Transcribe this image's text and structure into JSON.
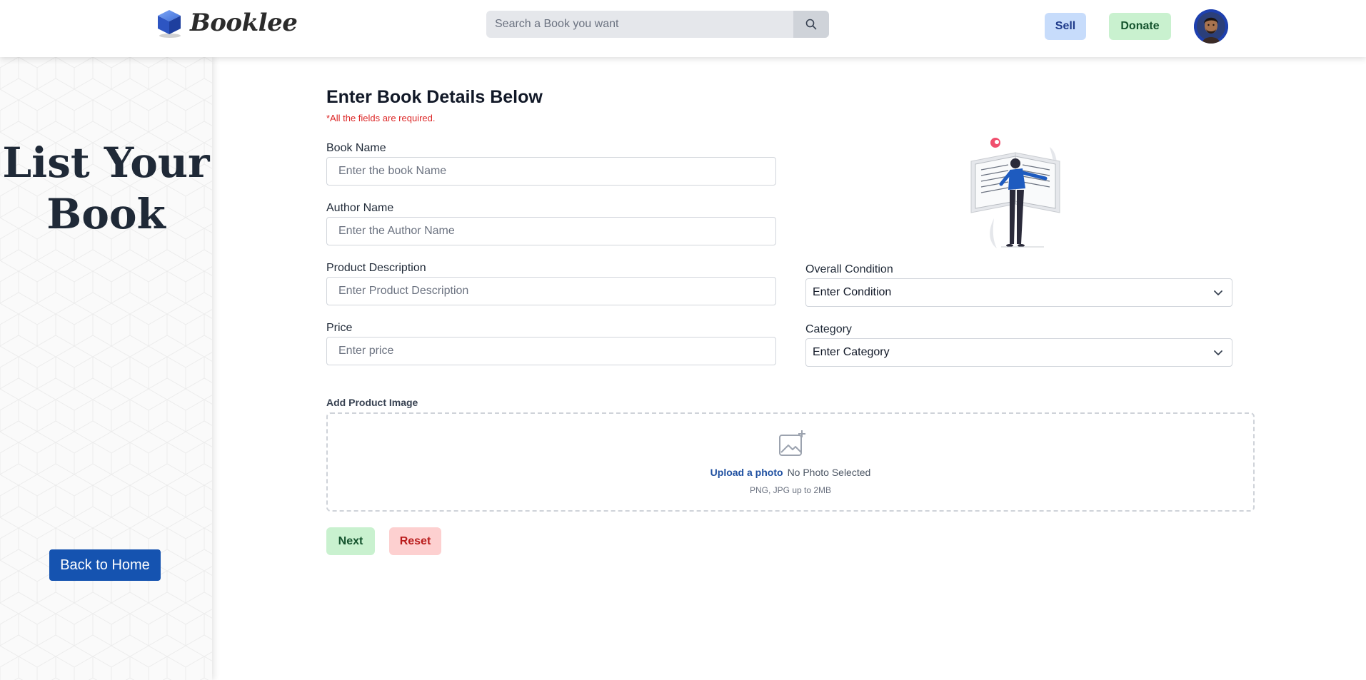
{
  "header": {
    "brand": "Booklee",
    "search_placeholder": "Search a Book you want",
    "sell_label": "Sell",
    "donate_label": "Donate"
  },
  "sidebar": {
    "title_line1": "List Your",
    "title_line2": "Book",
    "back_home_label": "Back to Home"
  },
  "form": {
    "title": "Enter Book Details Below",
    "required_note": "*All the fields are required.",
    "book_name": {
      "label": "Book Name",
      "placeholder": "Enter the book Name"
    },
    "author_name": {
      "label": "Author Name",
      "placeholder": "Enter the Author Name"
    },
    "description": {
      "label": "Product Description",
      "placeholder": "Enter Product Description"
    },
    "price": {
      "label": "Price",
      "placeholder": "Enter price"
    },
    "condition": {
      "label": "Overall Condition",
      "value": "Enter Condition"
    },
    "category": {
      "label": "Category",
      "value": "Enter Category"
    },
    "image": {
      "label": "Add Product Image",
      "upload_label": "Upload a photo",
      "status": "No Photo Selected",
      "hint": "PNG, JPG up to 2MB"
    },
    "next_label": "Next",
    "reset_label": "Reset"
  },
  "icons": {
    "logo": "cube-logo-icon",
    "search": "search-icon",
    "select": "chevron-down-icon",
    "upload": "image-add-icon"
  },
  "colors": {
    "primary_blue": "#1553b0",
    "sell_bg": "#c7dcfb",
    "donate_bg": "#c9f1cf",
    "reset_bg": "#fdd0d0",
    "required_red": "#dc2626"
  }
}
